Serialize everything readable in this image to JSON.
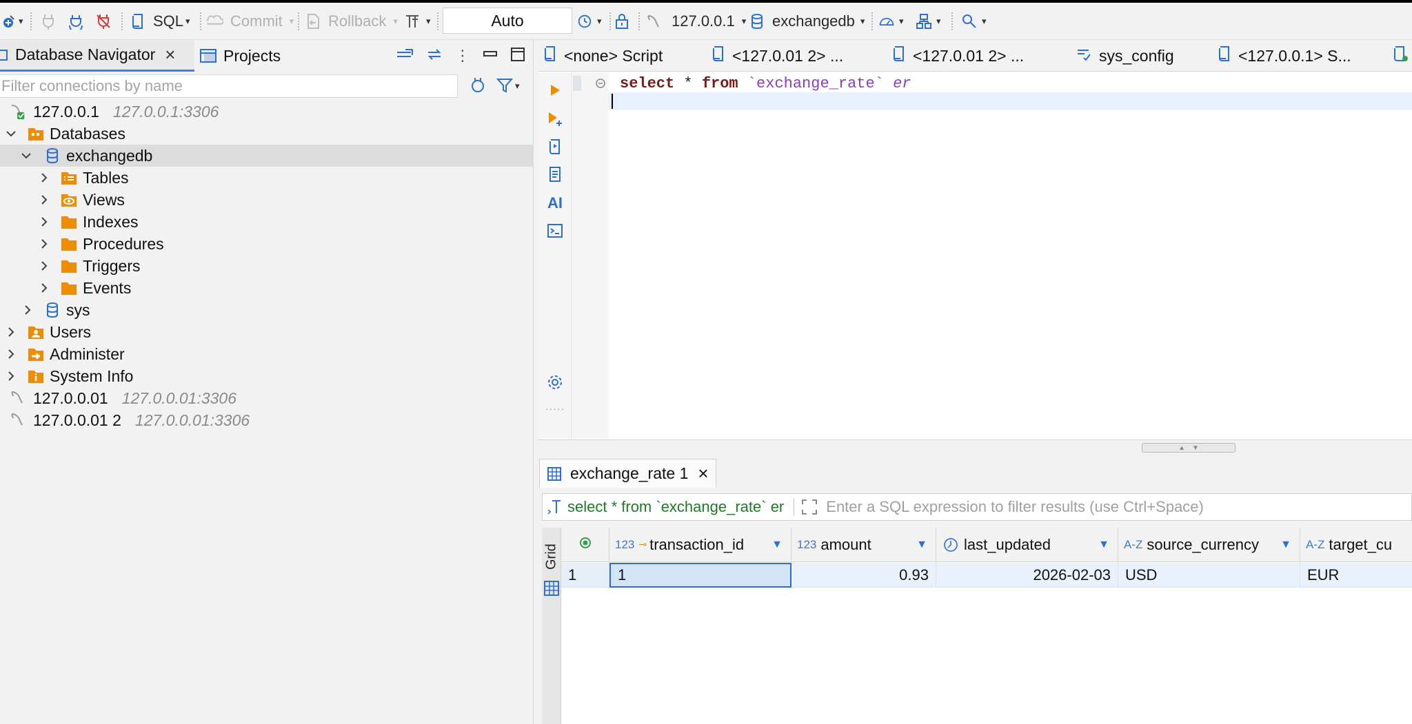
{
  "toolbar": {
    "sql_label": "SQL",
    "commit_label": "Commit",
    "rollback_label": "Rollback",
    "tx_mode": "Auto",
    "connection": "127.0.0.1",
    "database": "exchangedb"
  },
  "navigator": {
    "tab_active": "Database Navigator",
    "tab_other": "Projects",
    "filter_placeholder": "Filter connections by name",
    "tree": {
      "conn1": {
        "name": "127.0.0.1",
        "addr": "127.0.0.1:3306"
      },
      "databases": "Databases",
      "exchangedb": "exchangedb",
      "tables": "Tables",
      "views": "Views",
      "indexes": "Indexes",
      "procedures": "Procedures",
      "triggers": "Triggers",
      "events": "Events",
      "sys": "sys",
      "users": "Users",
      "administer": "Administer",
      "system_info": "System Info",
      "conn2": {
        "name": "127.0.0.01",
        "addr": "127.0.0.01:3306"
      },
      "conn3": {
        "name": "127.0.0.01 2",
        "addr": "127.0.0.01:3306"
      }
    }
  },
  "editor": {
    "tabs": [
      "<none> Script",
      "<127.0.01 2> ...",
      "<127.0.01 2> ...",
      "sys_config",
      "<127.0.0.1> S..."
    ],
    "code": {
      "kw_select": "select",
      "star": "*",
      "kw_from": "from",
      "table": "`exchange_rate`",
      "alias": "er"
    },
    "ai_label": "AI"
  },
  "results": {
    "tab_label": "exchange_rate 1",
    "query": "select * from `exchange_rate` er",
    "filter_placeholder": "Enter a SQL expression to filter results (use Ctrl+Space)",
    "side_label": "Grid",
    "columns": [
      {
        "type": "123",
        "name": "transaction_id",
        "key": true
      },
      {
        "type": "123",
        "name": "amount"
      },
      {
        "type": "clock",
        "name": "last_updated"
      },
      {
        "type": "A-Z",
        "name": "source_currency"
      },
      {
        "type": "A-Z",
        "name": "target_cu"
      }
    ],
    "rows": [
      {
        "num": "1",
        "transaction_id": "1",
        "amount": "0.93",
        "last_updated": "2026-02-03",
        "source_currency": "USD",
        "target_currency": "EUR"
      }
    ]
  },
  "colors": {
    "accent": "#3f7fe0",
    "keyword": "#7a1b1b",
    "string": "#8a3fb8",
    "query_green": "#1f7a2a",
    "folder_orange": "#f08c00"
  }
}
